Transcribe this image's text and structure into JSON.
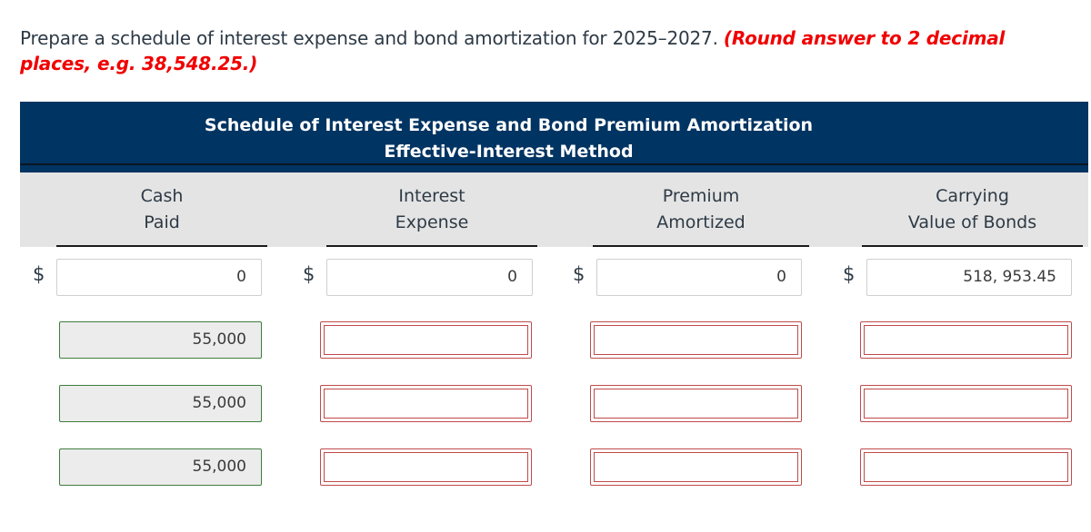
{
  "instructions": {
    "text": "Prepare a schedule of interest expense and bond amortization for 2025–2027.",
    "hint": "(Round answer to 2 decimal places, e.g. 38,548.25.)"
  },
  "table": {
    "title_line1": "Schedule of Interest Expense and Bond Premium Amortization",
    "title_line2": "Effective-Interest Method",
    "columns": [
      {
        "line1": "Cash",
        "line2": "Paid"
      },
      {
        "line1": "Interest",
        "line2": "Expense"
      },
      {
        "line1": "Premium",
        "line2": "Amortized"
      },
      {
        "line1": "Carrying",
        "line2": "Value of Bonds"
      }
    ],
    "currency_symbol": "$",
    "rows": [
      {
        "cash_paid": "0",
        "interest_expense": "0",
        "premium_amortized": "0",
        "carrying_value": "518, 953.45"
      },
      {
        "cash_paid": "55,000",
        "interest_expense": "",
        "premium_amortized": "",
        "carrying_value": ""
      },
      {
        "cash_paid": "55,000",
        "interest_expense": "",
        "premium_amortized": "",
        "carrying_value": ""
      },
      {
        "cash_paid": "55,000",
        "interest_expense": "",
        "premium_amortized": "",
        "carrying_value": ""
      }
    ]
  },
  "colors": {
    "banner": "#003462",
    "header_row": "#e4e4e4",
    "hint_red": "#f00000",
    "given_border": "#3f7d3f",
    "answer_border": "#c04a4a"
  }
}
